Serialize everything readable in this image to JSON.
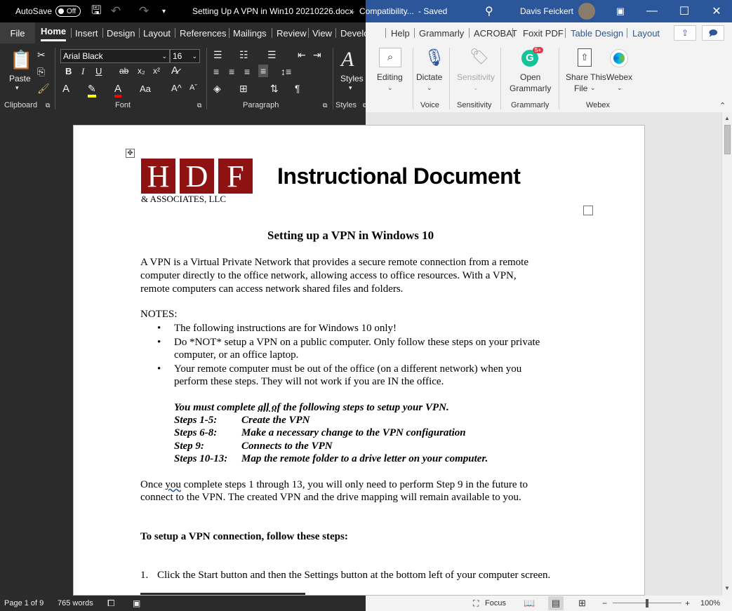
{
  "titlebar": {
    "autosave_label": "AutoSave",
    "autosave_state": "Off",
    "doc_title": "Setting Up A VPN in Win10 20210226.docx",
    "separator": "-",
    "compat": "Compatibility...",
    "saved": "- Saved",
    "user": "Davis Feickert"
  },
  "tabs": [
    "File",
    "Home",
    "Insert",
    "Design",
    "Layout",
    "References",
    "Mailings",
    "Review",
    "View",
    "Developer",
    "Help",
    "Grammarly",
    "ACROBAT",
    "Foxit PDF",
    "Table Design",
    "Layout"
  ],
  "ribbon": {
    "clipboard": {
      "paste": "Paste",
      "label": "Clipboard"
    },
    "font": {
      "name": "Arial Black",
      "size": "16",
      "label": "Font",
      "case": "Aa"
    },
    "paragraph": {
      "label": "Paragraph"
    },
    "styles": {
      "button": "Styles",
      "label": "Styles"
    },
    "editing": {
      "button": "Editing"
    },
    "voice": {
      "button": "Dictate",
      "label": "Voice"
    },
    "sensitivity": {
      "button": "Sensitivity",
      "label": "Sensitivity"
    },
    "grammarly": {
      "button_line1": "Open",
      "button_line2": "Grammarly",
      "label": "Grammarly",
      "badge": "5+"
    },
    "webex": {
      "share_line1": "Share This",
      "share_line2": "File",
      "webex": "Webex",
      "label": "Webex"
    }
  },
  "document": {
    "logo_letters": [
      "H",
      "D",
      "F"
    ],
    "logo_sub": "& ASSOCIATES, LLC",
    "header_title": "Instructional Document",
    "heading": "Setting up a VPN in Windows 10",
    "intro": [
      "A VPN is a Virtual Private Network that provides a secure remote connection from a remote",
      "computer directly to the office network, allowing access to office resources.  With a VPN,",
      "remote computers can access network shared files and folders."
    ],
    "notes_label": "NOTES:",
    "bullets": [
      "The following instructions are for Windows 10 only!",
      "Do *NOT* setup a VPN on a public computer.  Only follow these steps on your private",
      "computer, or an office laptop.",
      "Your remote computer must be out of the office (on a different network) when you",
      "perform these steps.  They will not work if you are IN the office."
    ],
    "must_prefix": "You must complete ",
    "must_underlined": "all of",
    "must_suffix": " the following steps to setup your VPN.",
    "steps": [
      {
        "label": "Steps 1-5:",
        "desc": "Create the VPN"
      },
      {
        "label": "Steps 6-8:",
        "desc": "Make a necessary change to the VPN configuration"
      },
      {
        "label": "Step 9:",
        "desc": "Connects to the VPN"
      },
      {
        "label": "Steps 10-13:",
        "desc": "Map the remote folder to a drive letter on your computer."
      }
    ],
    "once_prefix": "Once ",
    "once_underlined": "you",
    "once_rest": " complete steps 1 through 13, you will only need to perform Step 9 in the future to",
    "once_line2": "connect to the VPN.  The created VPN and the drive mapping will remain available to you.",
    "setup_heading": "To setup a VPN connection, follow these steps:",
    "step1_num": "1.",
    "step1_text": "Click the Start button and then the Settings button at the bottom left of your computer screen."
  },
  "statusbar": {
    "page": "Page 1 of 9",
    "words": "765 words",
    "focus": "Focus",
    "zoom": "100%"
  }
}
